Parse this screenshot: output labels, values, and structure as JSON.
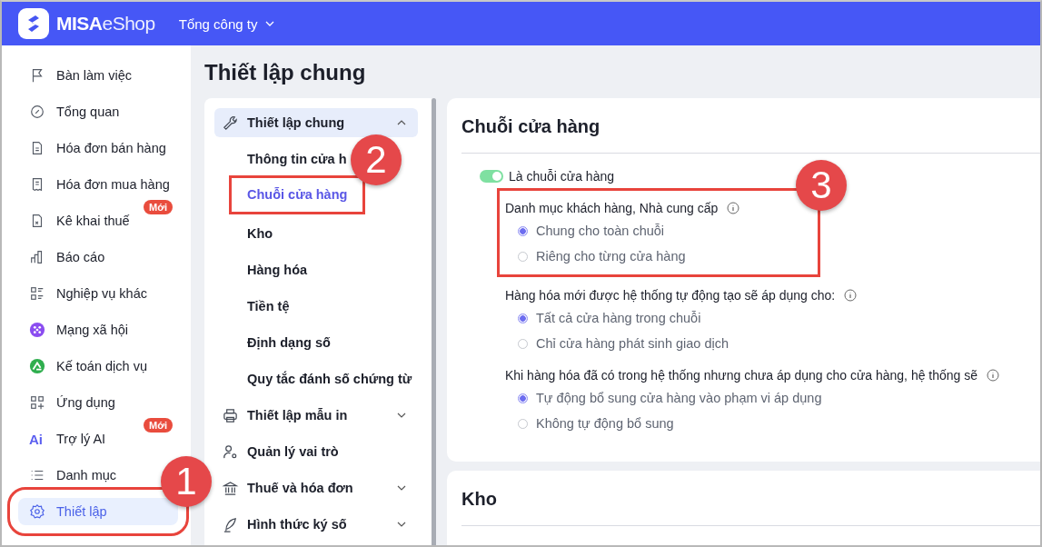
{
  "header": {
    "brand_bold": "MISA",
    "brand_light": "eShop",
    "org": "Tổng công ty"
  },
  "sidebar": {
    "items": [
      {
        "label": "Bàn làm việc",
        "selected": false
      },
      {
        "label": "Tổng quan",
        "selected": false
      },
      {
        "label": "Hóa đơn bán hàng",
        "selected": false
      },
      {
        "label": "Hóa đơn mua hàng",
        "selected": false
      },
      {
        "label": "Kê khai thuế",
        "selected": false,
        "badge": "Mới"
      },
      {
        "label": "Báo cáo",
        "selected": false
      },
      {
        "label": "Nghiệp vụ khác",
        "selected": false
      },
      {
        "label": "Mạng xã hội",
        "selected": false
      },
      {
        "label": "Kế toán dịch vụ",
        "selected": false
      },
      {
        "label": "Ứng dụng",
        "selected": false
      },
      {
        "label": "Trợ lý AI",
        "selected": false,
        "badge": "Mới",
        "icon_text": "Ai"
      },
      {
        "label": "Danh mục",
        "selected": false
      },
      {
        "label": "Thiết lập",
        "selected": true,
        "callout": "1"
      }
    ]
  },
  "page_title": "Thiết lập chung",
  "settings_nav": [
    {
      "label": "Thiết lập chung",
      "selected": true,
      "expanded": true,
      "children": [
        {
          "label": "Thông tin cửa h",
          "selected": false
        },
        {
          "label": "Chuỗi cửa hàng",
          "selected": true,
          "callout": "2"
        },
        {
          "label": "Kho",
          "selected": false
        },
        {
          "label": "Hàng hóa",
          "selected": false
        },
        {
          "label": "Tiền tệ",
          "selected": false
        },
        {
          "label": "Định dạng số",
          "selected": false
        },
        {
          "label": "Quy tắc đánh số chứng từ",
          "selected": false
        }
      ]
    },
    {
      "label": "Thiết lập mẫu in",
      "selected": false,
      "expanded": false
    },
    {
      "label": "Quản lý vai trò",
      "selected": false
    },
    {
      "label": "Thuế và hóa đơn",
      "selected": false,
      "expanded": false
    },
    {
      "label": "Hình thức ký số",
      "selected": false,
      "expanded": false
    }
  ],
  "sections": [
    {
      "title": "Chuỗi cửa hàng",
      "toggle": {
        "label": "Là chuỗi cửa hàng",
        "on": true
      },
      "groups": [
        {
          "title": "Danh mục khách hàng, Nhà cung cấp",
          "callout": "3",
          "options": [
            {
              "label": "Chung cho toàn chuỗi",
              "selected": true
            },
            {
              "label": "Riêng cho từng cửa hàng",
              "selected": false
            }
          ]
        },
        {
          "title": "Hàng hóa mới được hệ thống tự động tạo sẽ áp dụng cho:",
          "options": [
            {
              "label": "Tất cả cửa hàng trong chuỗi",
              "selected": true
            },
            {
              "label": "Chỉ cửa hàng phát sinh giao dịch",
              "selected": false
            }
          ]
        },
        {
          "title": "Khi hàng hóa đã có trong hệ thống nhưng chưa áp dụng cho cửa hàng, hệ thống sẽ",
          "options": [
            {
              "label": "Tự động bổ sung cửa hàng vào phạm vi áp dụng",
              "selected": true
            },
            {
              "label": "Không tự động bổ sung",
              "selected": false
            }
          ]
        }
      ]
    },
    {
      "title": "Kho"
    }
  ]
}
